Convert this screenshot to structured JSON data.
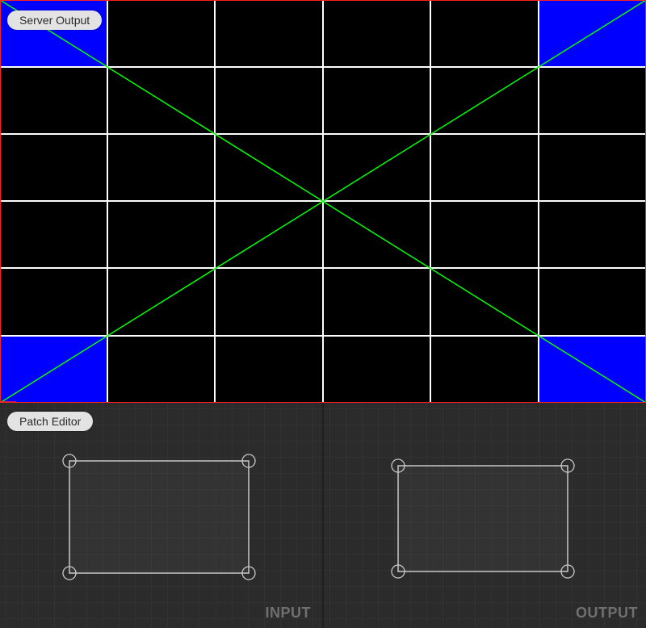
{
  "server_output": {
    "label": "Server Output",
    "grid": {
      "columns": 6,
      "rows": 6
    },
    "colors": {
      "background": "#000000",
      "grid_lines": "#ffffff",
      "corner_fill": "#0000ff",
      "diagonals": "#00ff00",
      "border": "#ff0000"
    }
  },
  "patch_editor": {
    "label": "Patch Editor",
    "input_panel": {
      "label": "INPUT"
    },
    "output_panel": {
      "label": "OUTPUT"
    },
    "colors": {
      "background": "#2b2b2b",
      "quad_outline": "#c8c8c8",
      "caption": "#707070"
    }
  }
}
